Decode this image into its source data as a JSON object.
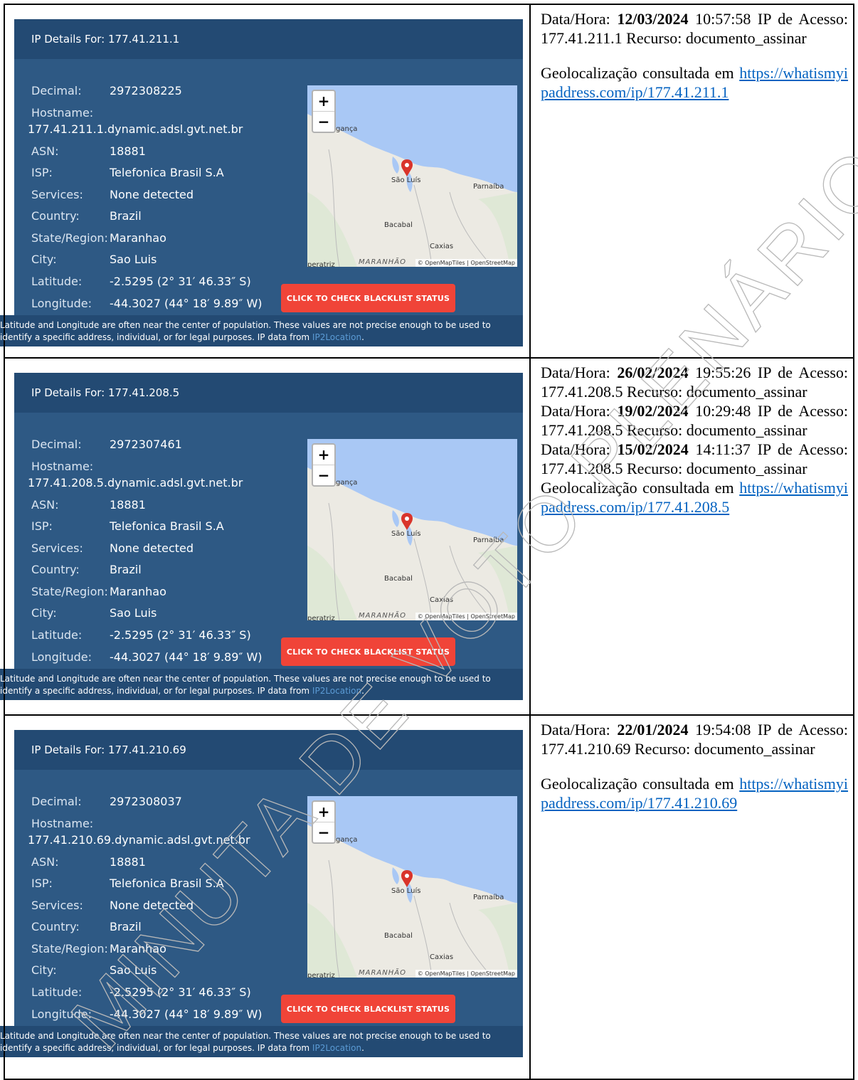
{
  "panels": [
    {
      "title": "IP Details For: 177.41.211.1",
      "decimal_label": "Decimal:",
      "decimal": "2972308225",
      "hostname_label": "Hostname:",
      "hostname": "177.41.211.1.dynamic.adsl.gvt.net.br",
      "asn_label": "ASN:",
      "asn": "18881",
      "isp_label": "ISP:",
      "isp": "Telefonica Brasil S.A",
      "services_label": "Services:",
      "services": "None detected",
      "country_label": "Country:",
      "country": "Brazil",
      "state_label": "State/Region:",
      "state": "Maranhao",
      "city_label": "City:",
      "city": "Sao Luis",
      "lat_label": "Latitude:",
      "lat": "-2.5295  (2° 31′ 46.33″ S)",
      "lon_label": "Longitude:",
      "lon": "-44.3027  (44° 18′ 9.89″ W)",
      "button": "CLICK TO CHECK BLACKLIST STATUS"
    },
    {
      "title": "IP Details For: 177.41.208.5",
      "decimal_label": "Decimal:",
      "decimal": "2972307461",
      "hostname_label": "Hostname:",
      "hostname": "177.41.208.5.dynamic.adsl.gvt.net.br",
      "asn_label": "ASN:",
      "asn": "18881",
      "isp_label": "ISP:",
      "isp": "Telefonica Brasil S.A",
      "services_label": "Services:",
      "services": "None detected",
      "country_label": "Country:",
      "country": "Brazil",
      "state_label": "State/Region:",
      "state": "Maranhao",
      "city_label": "City:",
      "city": "Sao Luis",
      "lat_label": "Latitude:",
      "lat": "-2.5295  (2° 31′ 46.33″ S)",
      "lon_label": "Longitude:",
      "lon": "-44.3027  (44° 18′ 9.89″ W)",
      "button": "CLICK TO CHECK BLACKLIST STATUS"
    },
    {
      "title": "IP Details For: 177.41.210.69",
      "decimal_label": "Decimal:",
      "decimal": "2972308037",
      "hostname_label": "Hostname:",
      "hostname": "177.41.210.69.dynamic.adsl.gvt.net.br",
      "asn_label": "ASN:",
      "asn": "18881",
      "isp_label": "ISP:",
      "isp": "Telefonica Brasil S.A",
      "services_label": "Services:",
      "services": "None detected",
      "country_label": "Country:",
      "country": "Brazil",
      "state_label": "State/Region:",
      "state": "Maranhao",
      "city_label": "City:",
      "city": "Sao Luis",
      "lat_label": "Latitude:",
      "lat": "-2.5295  (2° 31′ 46.33″ S)",
      "lon_label": "Longitude:",
      "lon": "-44.3027  (44° 18′ 9.89″ W)",
      "button": "CLICK TO CHECK BLACKLIST STATUS"
    }
  ],
  "map": {
    "zoom_in": "+",
    "zoom_out": "−",
    "label_braganca": "gança",
    "label_saoluis": "São Luís",
    "label_parnaiba": "Parnaíba",
    "label_bacabal": "Bacabal",
    "label_caxias": "Caxias",
    "label_maranhao": "MARANHÃO",
    "label_imperatriz": "peratriz",
    "attribution": "© OpenMapTiles | OpenStreetMap"
  },
  "footer": {
    "text": "Latitude and Longitude are often near the center of population. These values are not precise enough to be used to identify a specific address, individual, or for legal purposes. IP data from ",
    "link": "IP2Location",
    "end": "."
  },
  "entries": [
    {
      "rows": [
        {
          "label": "Data/Hora: ",
          "date": "12/03/2024",
          "rest": " 10:57:58 IP de Acesso: 177.41.211.1 Recurso: documento_assinar"
        }
      ],
      "geo_text": "Geolocalização consultada em ",
      "url": "https://whatismyipaddress.com/ip/177.41.211.1"
    },
    {
      "rows": [
        {
          "label": "Data/Hora: ",
          "date": "26/02/2024",
          "rest": " 19:55:26 IP de Acesso: 177.41.208.5 Recurso: documento_assinar"
        },
        {
          "label": "Data/Hora: ",
          "date": "19/02/2024",
          "rest": " 10:29:48 IP de Acesso: 177.41.208.5 Recurso: documento_assinar"
        },
        {
          "label": "Data/Hora: ",
          "date": "15/02/2024",
          "rest": " 14:11:37 IP de Acesso: 177.41.208.5 Recurso: documento_assinar"
        }
      ],
      "geo_text": "Geolocalização consultada em ",
      "url": "https://whatismyipaddress.com/ip/177.41.208.5"
    },
    {
      "rows": [
        {
          "label": "Data/Hora: ",
          "date": "22/01/2024",
          "rest": " 19:54:08 IP de Acesso: 177.41.210.69 Recurso: documento_assinar"
        }
      ],
      "geo_text": "Geolocalização consultada em ",
      "url": "https://whatismyipaddress.com/ip/177.41.210.69"
    }
  ],
  "watermark": "MINUTA DE VOTO PLENÁRIO VIRTUAL"
}
